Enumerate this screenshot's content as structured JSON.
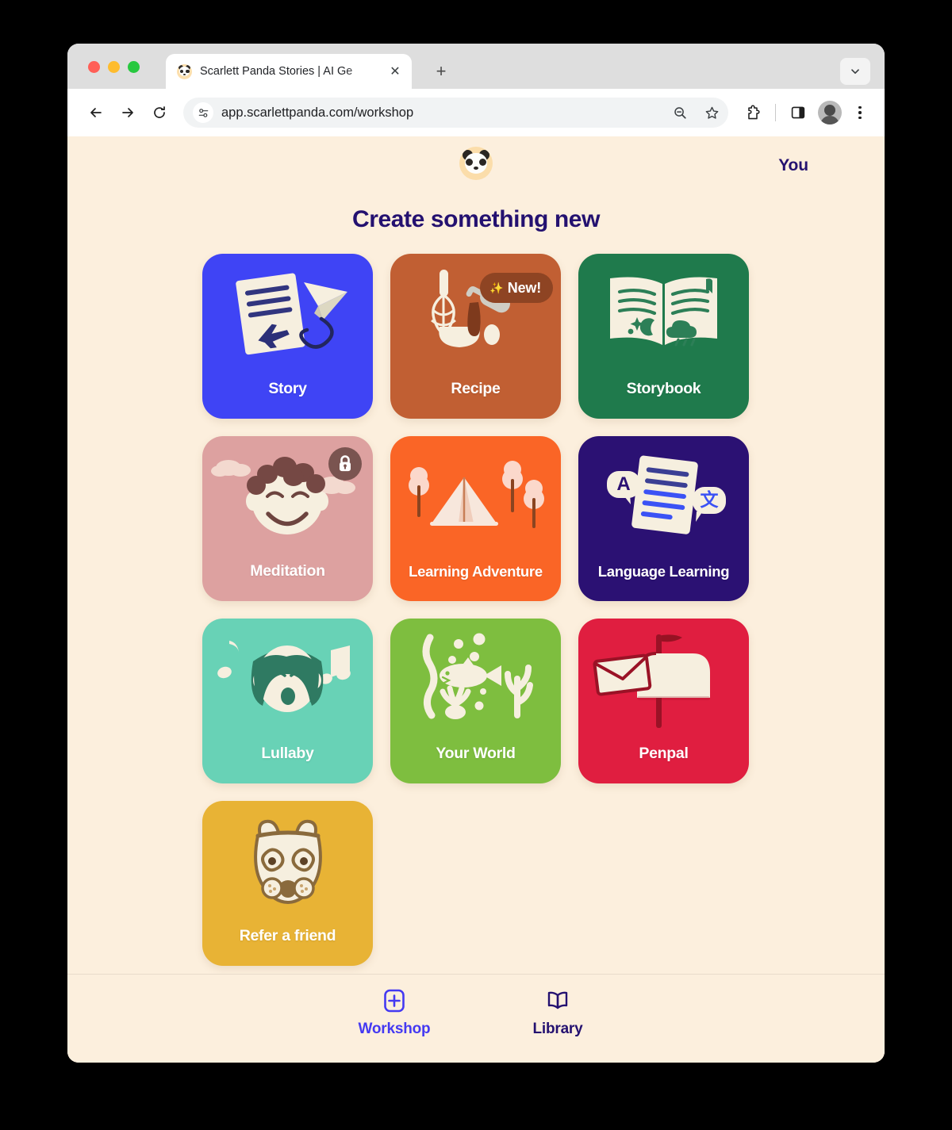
{
  "browser": {
    "tab_title": "Scarlett Panda Stories | AI Ge",
    "favicon_name": "panda-favicon",
    "close_tab_label": "✕",
    "new_tab_label": "+",
    "url": "app.scarlettpanda.com/workshop",
    "back_label": "back-arrow",
    "forward_label": "forward-arrow",
    "reload_label": "reload",
    "icons": {
      "site_info": "site-settings-icon",
      "zoom_out": "zoom-out-icon",
      "bookmark": "star-icon",
      "extensions": "puzzle-icon",
      "side_panel": "side-panel-icon",
      "profile": "profile-avatar",
      "menu": "three-dot-menu"
    }
  },
  "app": {
    "logo_name": "panda-logo",
    "account_link": "You",
    "title": "Create something new"
  },
  "cards": [
    {
      "id": "story",
      "label": "Story",
      "bg": "#3F44F5",
      "art": "paper-plane-letter-icon",
      "badge": null
    },
    {
      "id": "recipe",
      "label": "Recipe",
      "bg": "#C15F33",
      "art": "whisk-bowl-icon",
      "badge": {
        "type": "new",
        "label": "New!",
        "sparkle": "✨"
      }
    },
    {
      "id": "storybook",
      "label": "Storybook",
      "bg": "#1F7A4C",
      "art": "open-book-icon",
      "badge": null
    },
    {
      "id": "meditation",
      "label": "Meditation",
      "bg": "#DDA1A0",
      "art": "calm-face-clouds-icon",
      "badge": {
        "type": "lock",
        "label": "lock-icon"
      }
    },
    {
      "id": "learning-adventure",
      "label": "Learning Adventure",
      "bg": "#FA6526",
      "art": "tent-trees-icon",
      "badge": null
    },
    {
      "id": "language-learning",
      "label": "Language Learning",
      "bg": "#2B1173",
      "art": "translate-document-icon",
      "badge": null
    },
    {
      "id": "lullaby",
      "label": "Lullaby",
      "bg": "#68D2B6",
      "art": "singing-girl-notes-icon",
      "badge": null
    },
    {
      "id": "your-world",
      "label": "Your World",
      "bg": "#7EBE3F",
      "art": "underwater-fish-icon",
      "badge": null
    },
    {
      "id": "penpal",
      "label": "Penpal",
      "bg": "#E01E40",
      "art": "mailbox-envelope-icon",
      "badge": null
    },
    {
      "id": "refer-a-friend",
      "label": "Refer a friend",
      "bg": "#E8B335",
      "art": "panda-face-icon",
      "badge": null
    }
  ],
  "bottom_nav": [
    {
      "id": "workshop",
      "label": "Workshop",
      "icon": "plus-square-icon",
      "active": true
    },
    {
      "id": "library",
      "label": "Library",
      "icon": "open-book-icon",
      "active": false
    }
  ],
  "colors": {
    "page_bg": "#FCEFDD",
    "accent": "#4439F2",
    "heading": "#241170",
    "cream": "#F6EFDF"
  }
}
